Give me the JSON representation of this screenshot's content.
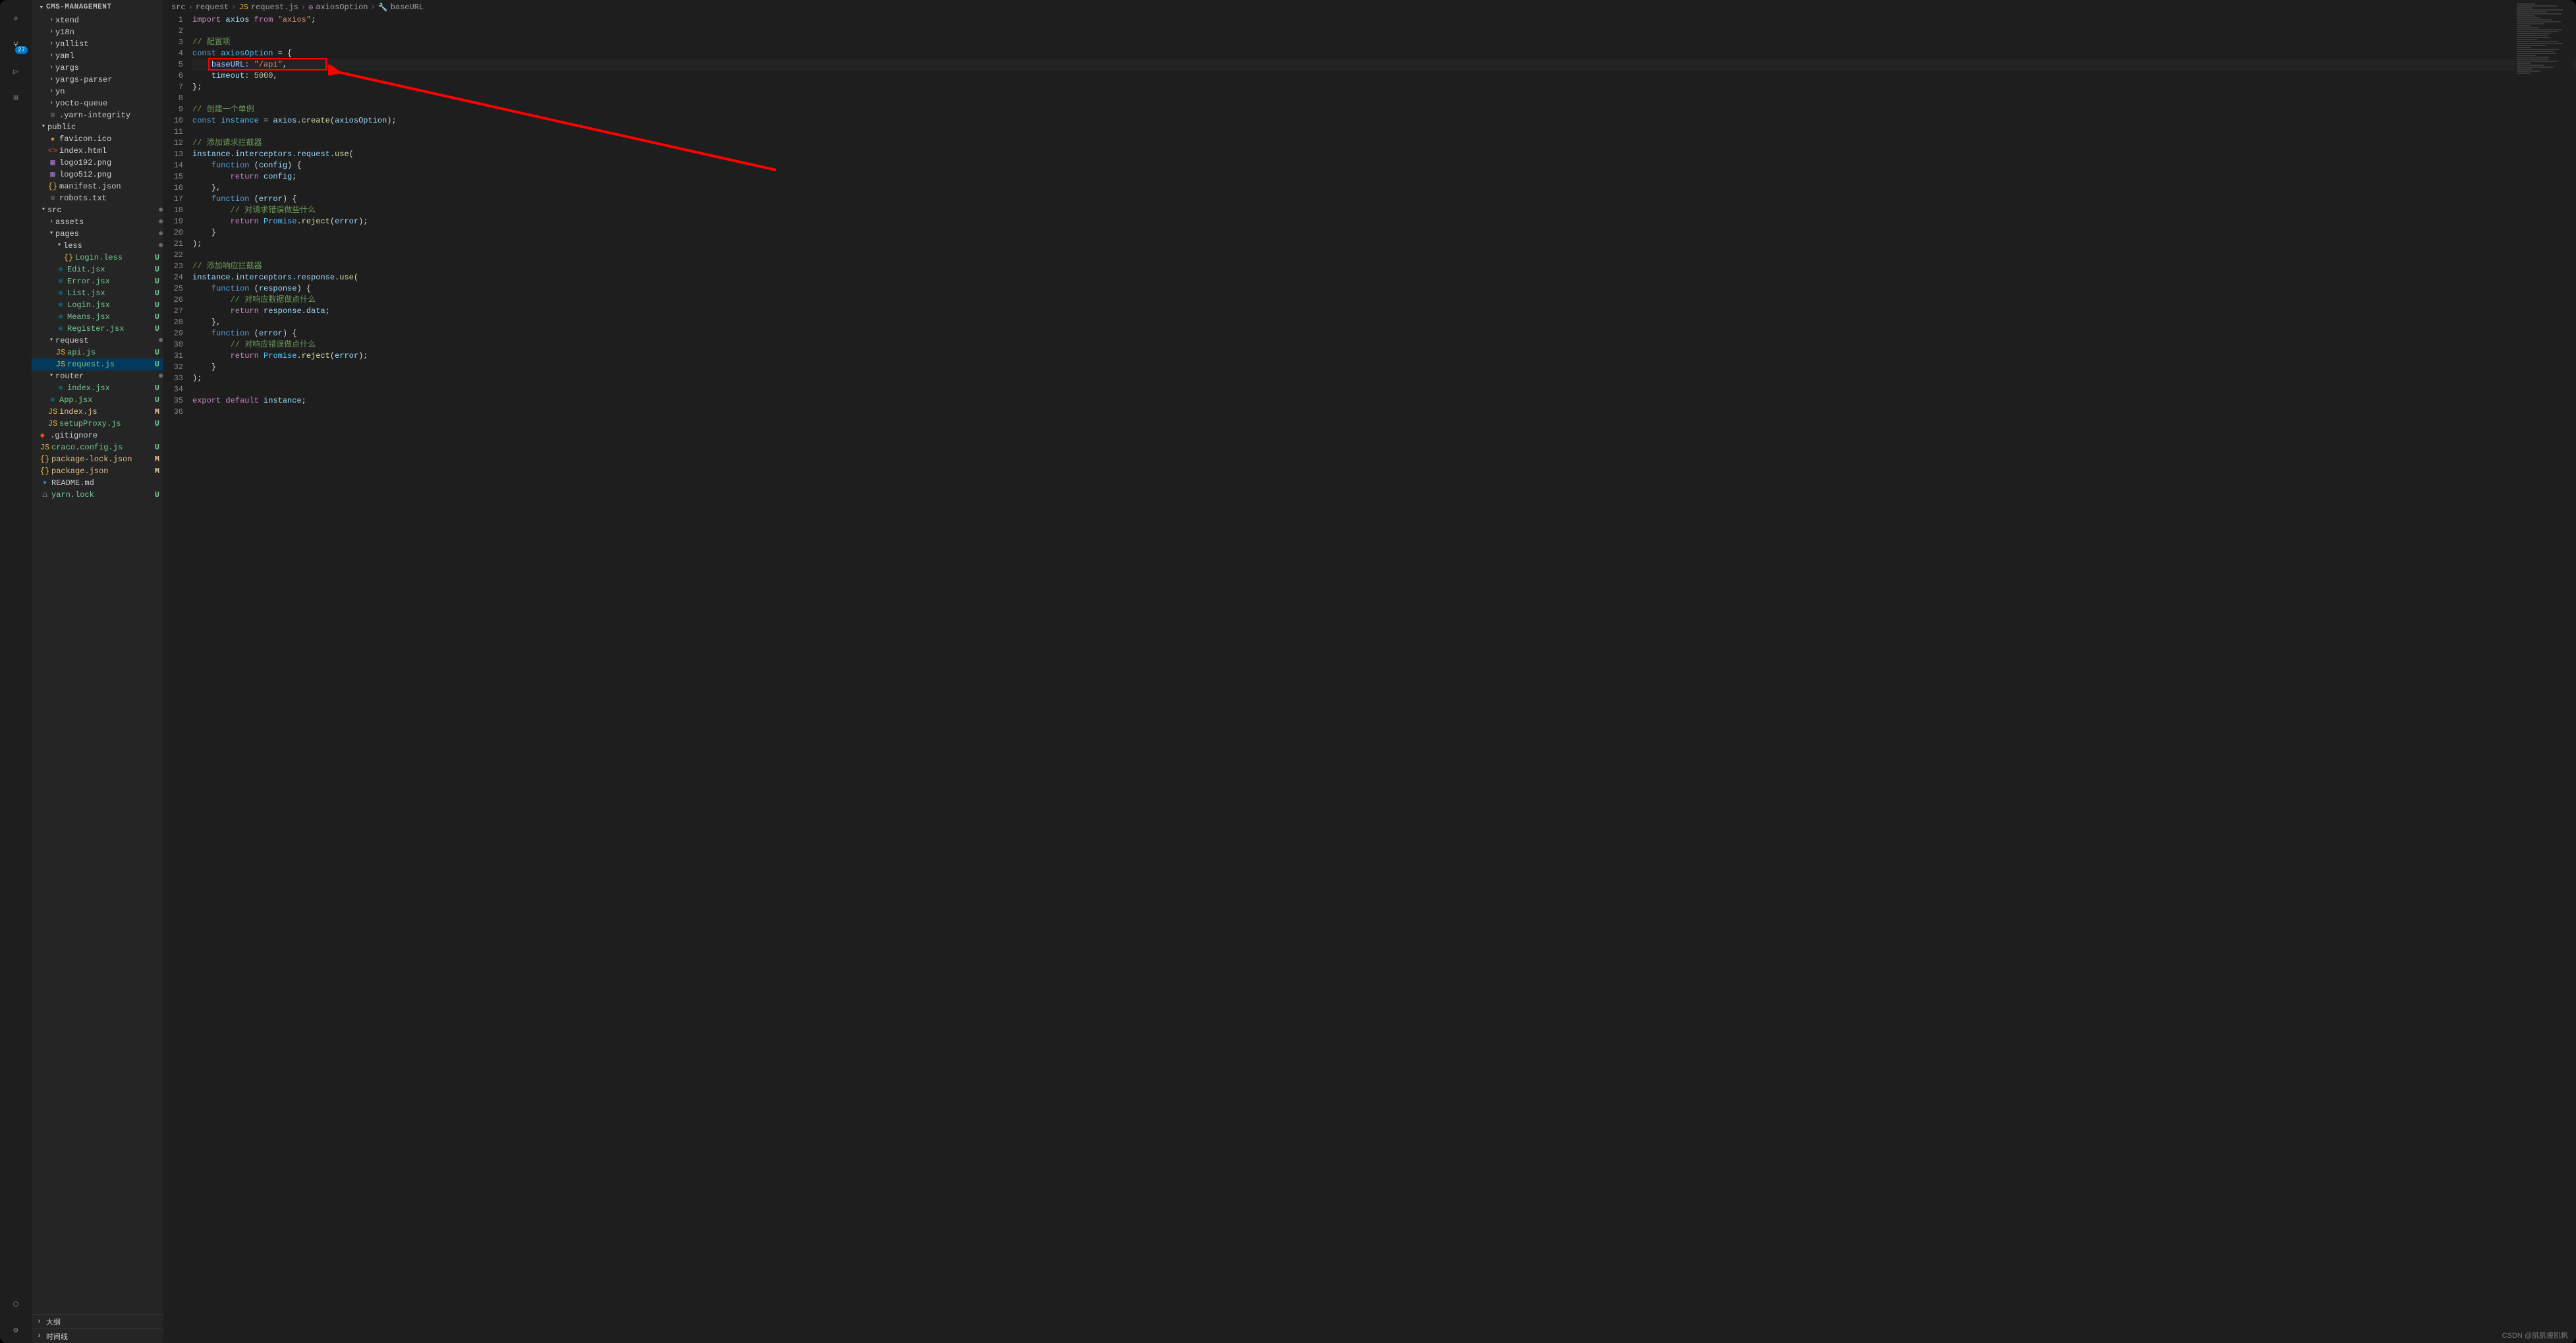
{
  "project": {
    "name": "CMS-MANAGEMENT"
  },
  "activityBar": {
    "items": [
      {
        "name": "search-icon",
        "glyph": "⌕",
        "active": false
      },
      {
        "name": "source-control-icon",
        "glyph": "⑂",
        "badge": "27",
        "active": true
      },
      {
        "name": "run-debug-icon",
        "glyph": "▷",
        "active": false
      },
      {
        "name": "extensions-icon",
        "glyph": "⊞",
        "active": false
      }
    ],
    "bottom": [
      {
        "name": "account-icon",
        "glyph": "◯"
      },
      {
        "name": "settings-gear-icon",
        "glyph": "⚙"
      }
    ]
  },
  "outlineSections": [
    {
      "label": "大纲"
    },
    {
      "label": "时间线"
    }
  ],
  "tree": [
    {
      "d": 2,
      "t": "folder",
      "open": false,
      "label": "xtend"
    },
    {
      "d": 2,
      "t": "folder",
      "open": false,
      "label": "y18n"
    },
    {
      "d": 2,
      "t": "folder",
      "open": false,
      "label": "yallist"
    },
    {
      "d": 2,
      "t": "folder",
      "open": false,
      "label": "yaml"
    },
    {
      "d": 2,
      "t": "folder",
      "open": false,
      "label": "yargs"
    },
    {
      "d": 2,
      "t": "folder",
      "open": false,
      "label": "yargs-parser"
    },
    {
      "d": 2,
      "t": "folder",
      "open": false,
      "label": "yn"
    },
    {
      "d": 2,
      "t": "folder",
      "open": false,
      "label": "yocto-queue"
    },
    {
      "d": 2,
      "t": "file",
      "ico": "txt",
      "label": ".yarn-integrity"
    },
    {
      "d": 1,
      "t": "folder",
      "open": true,
      "label": "public"
    },
    {
      "d": 2,
      "t": "file",
      "ico": "star",
      "label": "favicon.ico"
    },
    {
      "d": 2,
      "t": "file",
      "ico": "html",
      "label": "index.html"
    },
    {
      "d": 2,
      "t": "file",
      "ico": "img",
      "label": "logo192.png"
    },
    {
      "d": 2,
      "t": "file",
      "ico": "img",
      "label": "logo512.png"
    },
    {
      "d": 2,
      "t": "file",
      "ico": "json",
      "label": "manifest.json"
    },
    {
      "d": 2,
      "t": "file",
      "ico": "txt",
      "label": "robots.txt"
    },
    {
      "d": 1,
      "t": "folder",
      "open": true,
      "label": "src",
      "dot": true
    },
    {
      "d": 2,
      "t": "folder",
      "open": false,
      "label": "assets",
      "dot": true
    },
    {
      "d": 2,
      "t": "folder",
      "open": true,
      "label": "pages",
      "dot": true
    },
    {
      "d": 3,
      "t": "folder",
      "open": true,
      "label": "less",
      "dot": true
    },
    {
      "d": 4,
      "t": "file",
      "ico": "css",
      "label": "Login.less",
      "git": "U"
    },
    {
      "d": 3,
      "t": "file",
      "ico": "react",
      "label": "Edit.jsx",
      "git": "U"
    },
    {
      "d": 3,
      "t": "file",
      "ico": "react",
      "label": "Error.jsx",
      "git": "U"
    },
    {
      "d": 3,
      "t": "file",
      "ico": "react",
      "label": "List.jsx",
      "git": "U"
    },
    {
      "d": 3,
      "t": "file",
      "ico": "react",
      "label": "Login.jsx",
      "git": "U"
    },
    {
      "d": 3,
      "t": "file",
      "ico": "react",
      "label": "Means.jsx",
      "git": "U"
    },
    {
      "d": 3,
      "t": "file",
      "ico": "react",
      "label": "Register.jsx",
      "git": "U"
    },
    {
      "d": 2,
      "t": "folder",
      "open": true,
      "label": "request",
      "dot": true
    },
    {
      "d": 3,
      "t": "file",
      "ico": "js",
      "label": "api.js",
      "git": "U"
    },
    {
      "d": 3,
      "t": "file",
      "ico": "js",
      "label": "request.js",
      "git": "U",
      "selected": true
    },
    {
      "d": 2,
      "t": "folder",
      "open": true,
      "label": "router",
      "dot": true
    },
    {
      "d": 3,
      "t": "file",
      "ico": "react",
      "label": "index.jsx",
      "git": "U"
    },
    {
      "d": 2,
      "t": "file",
      "ico": "react",
      "label": "App.jsx",
      "git": "U"
    },
    {
      "d": 2,
      "t": "file",
      "ico": "js",
      "label": "index.js",
      "git": "M"
    },
    {
      "d": 2,
      "t": "file",
      "ico": "js",
      "label": "setupProxy.js",
      "git": "U"
    },
    {
      "d": 1,
      "t": "file",
      "ico": "git",
      "label": ".gitignore"
    },
    {
      "d": 1,
      "t": "file",
      "ico": "js",
      "label": "craco.config.js",
      "git": "U"
    },
    {
      "d": 1,
      "t": "file",
      "ico": "json",
      "label": "package-lock.json",
      "git": "M"
    },
    {
      "d": 1,
      "t": "file",
      "ico": "json",
      "label": "package.json",
      "git": "M"
    },
    {
      "d": 1,
      "t": "file",
      "ico": "md",
      "label": "README.md"
    },
    {
      "d": 1,
      "t": "file",
      "ico": "lock",
      "label": "yarn.lock",
      "git": "U"
    }
  ],
  "breadcrumbs": [
    {
      "label": "src"
    },
    {
      "label": "request"
    },
    {
      "label": "request.js",
      "ico": "js"
    },
    {
      "label": "axiosOption",
      "ico": "var"
    },
    {
      "label": "baseURL",
      "ico": "prop"
    }
  ],
  "code": {
    "lines": [
      {
        "n": 1,
        "h": "<span class='kw'>import</span> <span class='obj'>axios</span> <span class='kw'>from</span> <span class='str'>\"axios\"</span><span class='pun'>;</span>"
      },
      {
        "n": 2,
        "h": ""
      },
      {
        "n": 3,
        "h": "<span class='cmt'>// 配置项</span>"
      },
      {
        "n": 4,
        "h": "<span class='kw2'>const</span> <span class='var'>axiosOption</span> <span class='pun'>=</span> <span class='pun'>{</span>"
      },
      {
        "n": 5,
        "h": "    <span class='obj'>baseURL</span><span class='pun'>:</span> <span class='str'>\"/api\"</span><span class='pun'>,</span>",
        "cur": true
      },
      {
        "n": 6,
        "h": "    <span class='obj'>timeout</span><span class='pun'>:</span> <span class='num'>5000</span><span class='pun'>,</span>"
      },
      {
        "n": 7,
        "h": "<span class='pun'>};</span>"
      },
      {
        "n": 8,
        "h": ""
      },
      {
        "n": 9,
        "h": "<span class='cmt'>// 创建一个单例</span>"
      },
      {
        "n": 10,
        "h": "<span class='kw2'>const</span> <span class='var'>instance</span> <span class='pun'>=</span> <span class='obj'>axios</span><span class='pun'>.</span><span class='fn'>create</span><span class='pun'>(</span><span class='obj'>axiosOption</span><span class='pun'>);</span>"
      },
      {
        "n": 11,
        "h": ""
      },
      {
        "n": 12,
        "h": "<span class='cmt'>// 添加请求拦截器</span>"
      },
      {
        "n": 13,
        "h": "<span class='obj'>instance</span><span class='pun'>.</span><span class='obj'>interceptors</span><span class='pun'>.</span><span class='obj'>request</span><span class='pun'>.</span><span class='fn'>use</span><span class='pun'>(</span>"
      },
      {
        "n": 14,
        "h": "    <span class='kw2'>function</span> <span class='pun'>(</span><span class='obj'>config</span><span class='pun'>)</span> <span class='pun'>{</span>"
      },
      {
        "n": 15,
        "h": "        <span class='kw'>return</span> <span class='obj'>config</span><span class='pun'>;</span>"
      },
      {
        "n": 16,
        "h": "    <span class='pun'>},</span>"
      },
      {
        "n": 17,
        "h": "    <span class='kw2'>function</span> <span class='pun'>(</span><span class='obj'>error</span><span class='pun'>)</span> <span class='pun'>{</span>"
      },
      {
        "n": 18,
        "h": "        <span class='cmt'>// 对请求错误做些什么</span>"
      },
      {
        "n": 19,
        "h": "        <span class='kw'>return</span> <span class='var'>Promise</span><span class='pun'>.</span><span class='fn'>reject</span><span class='pun'>(</span><span class='obj'>error</span><span class='pun'>);</span>"
      },
      {
        "n": 20,
        "h": "    <span class='pun'>}</span>"
      },
      {
        "n": 21,
        "h": "<span class='pun'>);</span>"
      },
      {
        "n": 22,
        "h": ""
      },
      {
        "n": 23,
        "h": "<span class='cmt'>// 添加响应拦截器</span>"
      },
      {
        "n": 24,
        "h": "<span class='obj'>instance</span><span class='pun'>.</span><span class='obj'>interceptors</span><span class='pun'>.</span><span class='obj'>response</span><span class='pun'>.</span><span class='fn'>use</span><span class='pun'>(</span>"
      },
      {
        "n": 25,
        "h": "    <span class='kw2'>function</span> <span class='pun'>(</span><span class='obj'>response</span><span class='pun'>)</span> <span class='pun'>{</span>"
      },
      {
        "n": 26,
        "h": "        <span class='cmt'>// 对响应数据做点什么</span>"
      },
      {
        "n": 27,
        "h": "        <span class='kw'>return</span> <span class='obj'>response</span><span class='pun'>.</span><span class='obj'>data</span><span class='pun'>;</span>"
      },
      {
        "n": 28,
        "h": "    <span class='pun'>},</span>"
      },
      {
        "n": 29,
        "h": "    <span class='kw2'>function</span> <span class='pun'>(</span><span class='obj'>error</span><span class='pun'>)</span> <span class='pun'>{</span>"
      },
      {
        "n": 30,
        "h": "        <span class='cmt'>// 对响应错误做点什么</span>"
      },
      {
        "n": 31,
        "h": "        <span class='kw'>return</span> <span class='var'>Promise</span><span class='pun'>.</span><span class='fn'>reject</span><span class='pun'>(</span><span class='obj'>error</span><span class='pun'>);</span>"
      },
      {
        "n": 32,
        "h": "    <span class='pun'>}</span>"
      },
      {
        "n": 33,
        "h": "<span class='pun'>);</span>"
      },
      {
        "n": 34,
        "h": ""
      },
      {
        "n": 35,
        "h": "<span class='kw'>export</span> <span class='kw'>default</span> <span class='obj'>instance</span><span class='pun'>;</span>"
      },
      {
        "n": 36,
        "h": ""
      }
    ]
  },
  "watermark": "CSDN @肌肌瘦肌帆"
}
